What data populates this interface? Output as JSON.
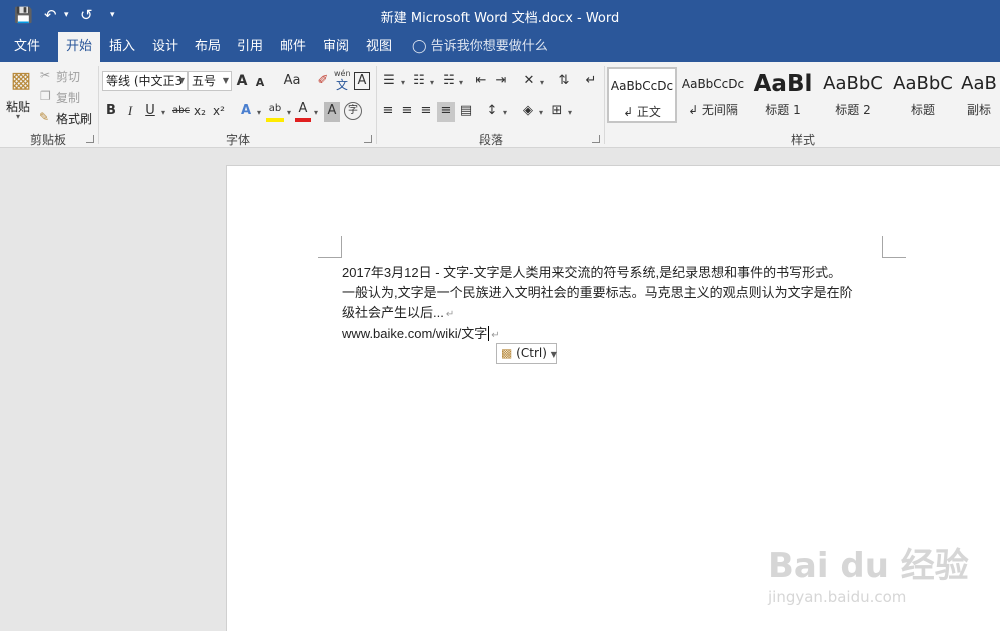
{
  "window": {
    "title": "新建 Microsoft Word 文档.docx  -  Word",
    "quick_access": {
      "save": "💾",
      "undo": "↶",
      "undo_arrow": "▾",
      "redo": "↺",
      "customize": "▾"
    }
  },
  "tabs": [
    {
      "label": "文件"
    },
    {
      "label": "开始"
    },
    {
      "label": "插入"
    },
    {
      "label": "设计"
    },
    {
      "label": "布局"
    },
    {
      "label": "引用"
    },
    {
      "label": "邮件"
    },
    {
      "label": "审阅"
    },
    {
      "label": "视图"
    }
  ],
  "tell_me": "告诉我你想要做什么",
  "clipboard": {
    "paste": "粘贴",
    "cut": "剪切",
    "copy": "复制",
    "format_painter": "格式刷",
    "group": "剪贴板"
  },
  "font": {
    "font_name": "等线 (中文正3",
    "font_size": "五号",
    "group": "字体",
    "grow": "A",
    "shrink": "A",
    "case": "Aa",
    "bold": "B",
    "italic": "I",
    "underline": "U",
    "strike": "abc",
    "subscript": "x₂",
    "superscript": "x²",
    "pinyin_top": "wén",
    "pinyin_bottom": "文",
    "border_char": "A",
    "effects": "A",
    "highlight": "ab",
    "color": "A",
    "shading": "A",
    "circled": "字"
  },
  "paragraph": {
    "group": "段落"
  },
  "styles": {
    "group": "样式",
    "items": [
      {
        "sample": "AaBbCcDc",
        "name": "↲ 正文"
      },
      {
        "sample": "AaBbCcDc",
        "name": "↲ 无间隔"
      },
      {
        "sample": "AaBl",
        "name": "标题 1"
      },
      {
        "sample": "AaBbC",
        "name": "标题 2"
      },
      {
        "sample": "AaBbC",
        "name": "标题"
      },
      {
        "sample": "AaB",
        "name": "副标"
      }
    ]
  },
  "document": {
    "lines": [
      "2017年3月12日  -  文字-文字是人类用来交流的符号系统,是纪录思想和事件的书写形式。",
      "一般认为,文字是一个民族进入文明社会的重要标志。马克思主义的观点则认为文字是在阶",
      "级社会产生以后...",
      "www.baike.com/wiki/文字"
    ],
    "paragraph_mark": "↵",
    "paste_options": "(Ctrl)"
  },
  "watermark": {
    "main": "Bai du 经验",
    "sub": "jingyan.baidu.com"
  }
}
